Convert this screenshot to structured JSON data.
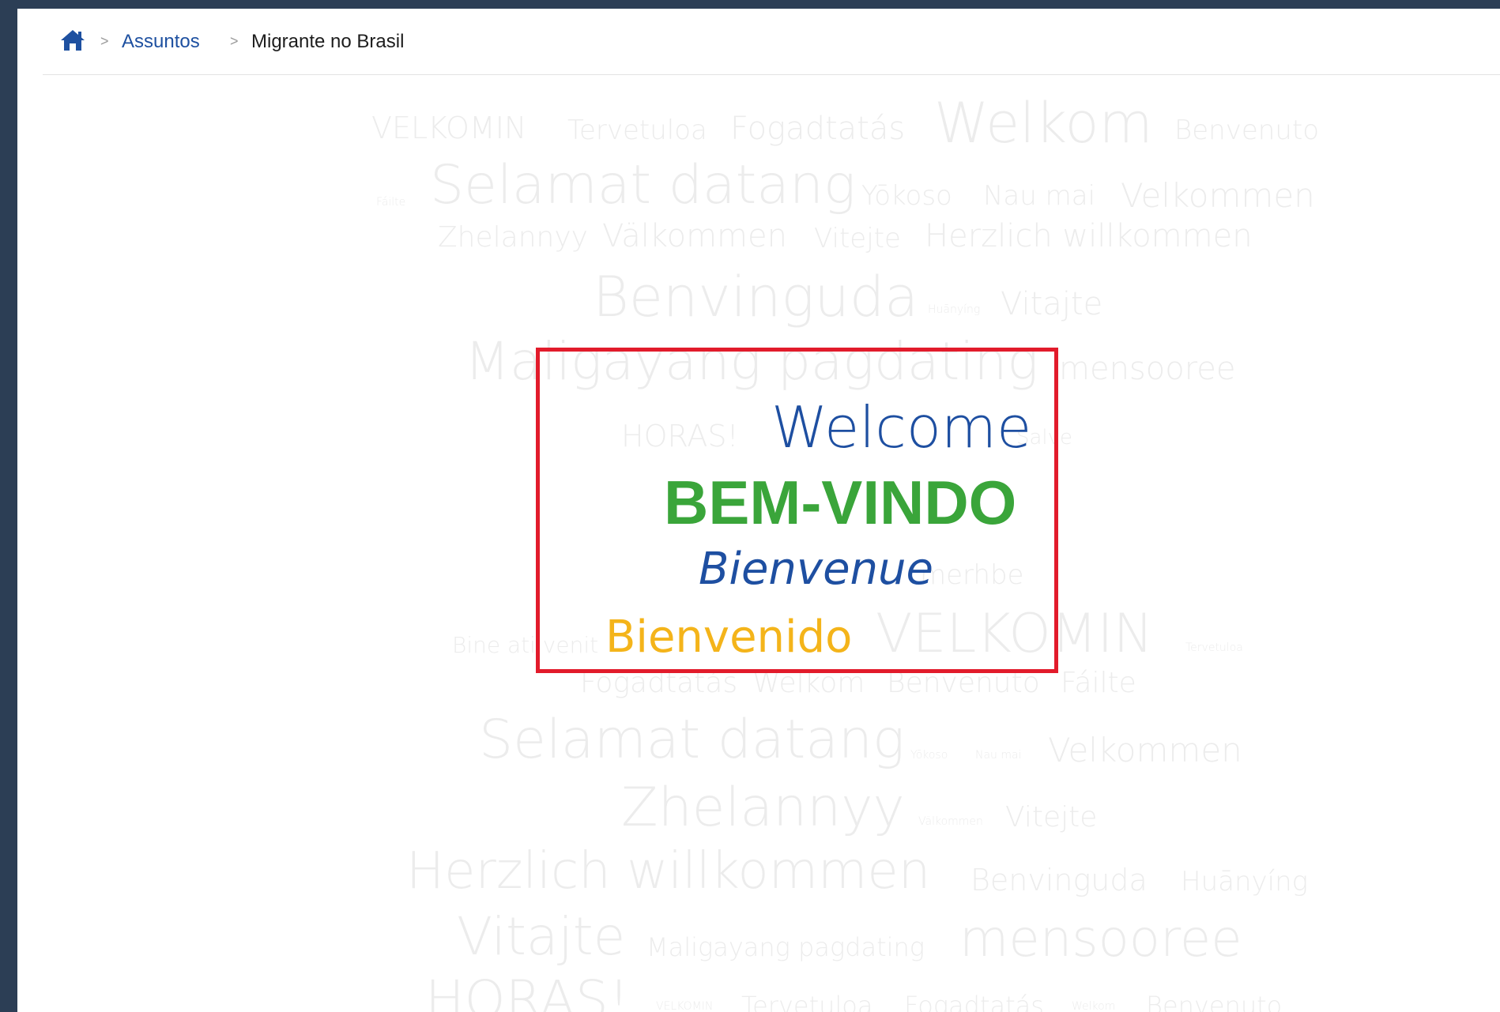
{
  "breadcrumb": {
    "home_icon": "home-icon",
    "separator": ">",
    "items": [
      {
        "label": "Assuntos"
      },
      {
        "label": "Migrante no Brasil"
      }
    ]
  },
  "colors": {
    "background": "#2c3e55",
    "link": "#1e50a0",
    "highlight_border": "#e21b2b",
    "welcome": "#1e4fa1",
    "bem_vindo": "#3aa53a",
    "bienvenue": "#1e4fa1",
    "bienvenido": "#f4b41a",
    "faded_words": "#ececec"
  },
  "word_cloud": {
    "words": [
      "VELKOMIN",
      "Tervetuloa",
      "Fogadtatás",
      "Welkom",
      "Benvenuto",
      "Fáilte",
      "Selamat datang",
      "Yōkoso",
      "Nau mai",
      "Velkommen",
      "Zhelannyy",
      "Välkommen",
      "Vitejte",
      "Herzlich willkommen",
      "Benvinguda",
      "Huānyíng",
      "Vitajte",
      "Maligayang pagdating",
      "mensooree",
      "HORAS!",
      "Salve",
      "merhbe",
      "Bine ati venit",
      "VELKOMIN",
      "Tervetuloa",
      "Fogadtatás",
      "Welkom",
      "Benvenuto",
      "Fáilte",
      "Selamat datang",
      "Yōkoso",
      "Nau mai",
      "Velkommen",
      "Zhelannyy",
      "Välkommen",
      "Vitejte",
      "Herzlich willkommen",
      "Benvinguda",
      "Huānyíng",
      "Vitajte",
      "Maligayang pagdating",
      "mensooree",
      "HORAS!",
      "VELKOMIN",
      "Tervetuloa",
      "Fogadtatás",
      "Welkom",
      "Benvenuto"
    ],
    "highlighted": {
      "welcome": "Welcome",
      "bem_vindo": "BEM-VINDO",
      "bienvenue": "Bienvenue",
      "bienvenido": "Bienvenido"
    }
  }
}
